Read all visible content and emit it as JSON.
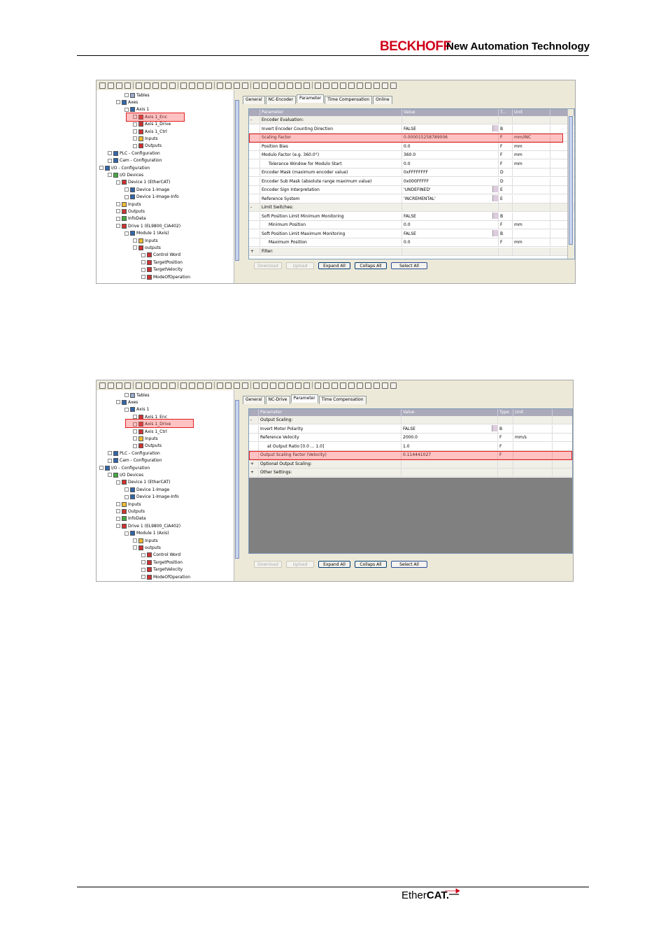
{
  "header": {
    "brand": "BECKHOFF",
    "tagline": "New Automation Technology"
  },
  "footer": {
    "logo_prefix": "Ether",
    "logo_suffix": "CAT."
  },
  "shot1": {
    "tree": [
      {
        "label": "Tables",
        "indent": 3,
        "icon": "table"
      },
      {
        "label": "Axes",
        "indent": 2,
        "icon": "axes"
      },
      {
        "label": "Axis 1",
        "indent": 3,
        "icon": "axis"
      },
      {
        "label": "Axis 1_Enc",
        "indent": 4,
        "icon": "enc"
      },
      {
        "label": "Axis 1_Drive",
        "indent": 4,
        "icon": "drive"
      },
      {
        "label": "Axis 1_Ctrl",
        "indent": 4,
        "icon": "ctrl"
      },
      {
        "label": "Inputs",
        "indent": 4,
        "icon": "inputs"
      },
      {
        "label": "Outputs",
        "indent": 4,
        "icon": "outputs"
      },
      {
        "label": "PLC - Configuration",
        "indent": 1,
        "icon": "plc"
      },
      {
        "label": "Cam - Configuration",
        "indent": 1,
        "icon": "cam"
      },
      {
        "label": "I/O - Configuration",
        "indent": 0,
        "icon": "io"
      },
      {
        "label": "I/O Devices",
        "indent": 1,
        "icon": "io-devices"
      },
      {
        "label": "Device 1 (EtherCAT)",
        "indent": 2,
        "icon": "device"
      },
      {
        "label": "Device 1-Image",
        "indent": 3,
        "icon": "image"
      },
      {
        "label": "Device 1-Image-Info",
        "indent": 3,
        "icon": "image"
      },
      {
        "label": "Inputs",
        "indent": 2,
        "icon": "inputs"
      },
      {
        "label": "Outputs",
        "indent": 2,
        "icon": "outputs"
      },
      {
        "label": "InfoData",
        "indent": 2,
        "icon": "infodata"
      },
      {
        "label": "Drive 1 (EL9800_CiA402)",
        "indent": 2,
        "icon": "drive"
      },
      {
        "label": "Module 1 (Axis)",
        "indent": 3,
        "icon": "module"
      },
      {
        "label": "Inputs",
        "indent": 4,
        "icon": "inputs"
      },
      {
        "label": "outputs",
        "indent": 4,
        "icon": "outputs"
      },
      {
        "label": "Control Word",
        "indent": 5,
        "icon": "var"
      },
      {
        "label": "TargetPosition",
        "indent": 5,
        "icon": "var"
      },
      {
        "label": "TargetVelocity",
        "indent": 5,
        "icon": "var"
      },
      {
        "label": "ModeOfOperation",
        "indent": 5,
        "icon": "var"
      }
    ],
    "tabs": [
      "General",
      "NC-Encoder",
      "Parameter",
      "Time Compensation",
      "Online"
    ],
    "columns": [
      "Parameter",
      "Value",
      "T...",
      "Unit"
    ],
    "rows": [
      {
        "sign": "-",
        "param": "Encoder Evaluation:",
        "value": "",
        "t": "",
        "unit": "",
        "group": true
      },
      {
        "sign": "",
        "param": "Invert Encoder Counting Direction",
        "value": "FALSE",
        "t": "B",
        "unit": "",
        "dd": true
      },
      {
        "sign": "",
        "param": "Scaling Factor",
        "value": "0.000015258789006",
        "t": "F",
        "unit": "mm/INC"
      },
      {
        "sign": "",
        "param": "Position Bias",
        "value": "0.0",
        "t": "F",
        "unit": "mm"
      },
      {
        "sign": "",
        "param": "Modulo Factor (e.g. 360.0°)",
        "value": "360.0",
        "t": "F",
        "unit": "mm"
      },
      {
        "sign": "",
        "param": "Tolerance Window for Modulo Start",
        "value": "0.0",
        "t": "F",
        "unit": "mm",
        "sub": true
      },
      {
        "sign": "",
        "param": "Encoder Mask (maximum encoder value)",
        "value": "0xFFFFFFFF",
        "t": "D",
        "unit": ""
      },
      {
        "sign": "",
        "param": "Encoder Sub Mask (absolute range maximum value)",
        "value": "0x000FFFFF",
        "t": "D",
        "unit": ""
      },
      {
        "sign": "",
        "param": "Encoder Sign Interpretation",
        "value": "'UNDEFINED'",
        "t": "E",
        "unit": "",
        "dd": true
      },
      {
        "sign": "",
        "param": "Reference System",
        "value": "'INCREMENTAL'",
        "t": "E",
        "unit": "",
        "dd": true
      },
      {
        "sign": "-",
        "param": "Limit Switches:",
        "value": "",
        "t": "",
        "unit": "",
        "group": true
      },
      {
        "sign": "",
        "param": "Soft Position Limit Minimum Monitoring",
        "value": "FALSE",
        "t": "B",
        "unit": "",
        "dd": true
      },
      {
        "sign": "",
        "param": "Minimum Position",
        "value": "0.0",
        "t": "F",
        "unit": "mm",
        "sub": true
      },
      {
        "sign": "",
        "param": "Soft Position Limit Maximum Monitoring",
        "value": "FALSE",
        "t": "B",
        "unit": "",
        "dd": true
      },
      {
        "sign": "",
        "param": "Maximum Position",
        "value": "0.0",
        "t": "F",
        "unit": "mm",
        "sub": true
      },
      {
        "sign": "+",
        "param": "Filter:",
        "value": "",
        "t": "",
        "unit": "",
        "group": true
      }
    ],
    "buttons": [
      "Download",
      "Upload",
      "Expand All",
      "Collaps All",
      "Select All"
    ]
  },
  "shot2": {
    "tree": [
      {
        "label": "Tables",
        "indent": 3,
        "icon": "table"
      },
      {
        "label": "Axes",
        "indent": 2,
        "icon": "axes"
      },
      {
        "label": "Axis 1",
        "indent": 3,
        "icon": "axis"
      },
      {
        "label": "Axis 1_Enc",
        "indent": 4,
        "icon": "enc"
      },
      {
        "label": "Axis 1_Drive",
        "indent": 4,
        "icon": "drive"
      },
      {
        "label": "Axis 1_Ctrl",
        "indent": 4,
        "icon": "ctrl"
      },
      {
        "label": "Inputs",
        "indent": 4,
        "icon": "inputs"
      },
      {
        "label": "Outputs",
        "indent": 4,
        "icon": "outputs"
      },
      {
        "label": "PLC - Configuration",
        "indent": 1,
        "icon": "plc"
      },
      {
        "label": "Cam - Configuration",
        "indent": 1,
        "icon": "cam"
      },
      {
        "label": "I/O - Configuration",
        "indent": 0,
        "icon": "io"
      },
      {
        "label": "I/O Devices",
        "indent": 1,
        "icon": "io-devices"
      },
      {
        "label": "Device 1 (EtherCAT)",
        "indent": 2,
        "icon": "device"
      },
      {
        "label": "Device 1-Image",
        "indent": 3,
        "icon": "image"
      },
      {
        "label": "Device 1-Image-Info",
        "indent": 3,
        "icon": "image"
      },
      {
        "label": "Inputs",
        "indent": 2,
        "icon": "inputs"
      },
      {
        "label": "Outputs",
        "indent": 2,
        "icon": "outputs"
      },
      {
        "label": "InfoData",
        "indent": 2,
        "icon": "infodata"
      },
      {
        "label": "Drive 1 (EL9800_CiA402)",
        "indent": 2,
        "icon": "drive"
      },
      {
        "label": "Module 1 (Axis)",
        "indent": 3,
        "icon": "module"
      },
      {
        "label": "Inputs",
        "indent": 4,
        "icon": "inputs"
      },
      {
        "label": "outputs",
        "indent": 4,
        "icon": "outputs"
      },
      {
        "label": "Control Word",
        "indent": 5,
        "icon": "var"
      },
      {
        "label": "TargetPosition",
        "indent": 5,
        "icon": "var"
      },
      {
        "label": "TargetVelocity",
        "indent": 5,
        "icon": "var"
      },
      {
        "label": "ModeOfOperation",
        "indent": 5,
        "icon": "var"
      }
    ],
    "tabs": [
      "General",
      "NC-Drive",
      "Parameter",
      "Time Compensation"
    ],
    "columns": [
      "Parameter",
      "Value",
      "Type",
      "Unit"
    ],
    "rows": [
      {
        "sign": "-",
        "param": "Output Scaling:",
        "value": "",
        "t": "",
        "unit": "",
        "group": true
      },
      {
        "sign": "",
        "param": "Invert Motor Polarity",
        "value": "FALSE",
        "t": "B",
        "unit": "",
        "dd": true
      },
      {
        "sign": "",
        "param": "Reference Velocity",
        "value": "2000.0",
        "t": "F",
        "unit": "mm/s"
      },
      {
        "sign": "",
        "param": "at Output Ratio [0.0 ... 1.0]",
        "value": "1.0",
        "t": "F",
        "unit": "",
        "sub": true
      },
      {
        "sign": "",
        "param": "Output Scaling Factor (Velocity)",
        "value": "0.114441027",
        "t": "F",
        "unit": ""
      },
      {
        "sign": "+",
        "param": "Optional Output Scaling:",
        "value": "",
        "t": "",
        "unit": "",
        "group": true
      },
      {
        "sign": "+",
        "param": "Other Settings:",
        "value": "",
        "t": "",
        "unit": "",
        "group": true
      }
    ],
    "buttons": [
      "Download",
      "Upload",
      "Expand All",
      "Collaps All",
      "Select All"
    ]
  }
}
